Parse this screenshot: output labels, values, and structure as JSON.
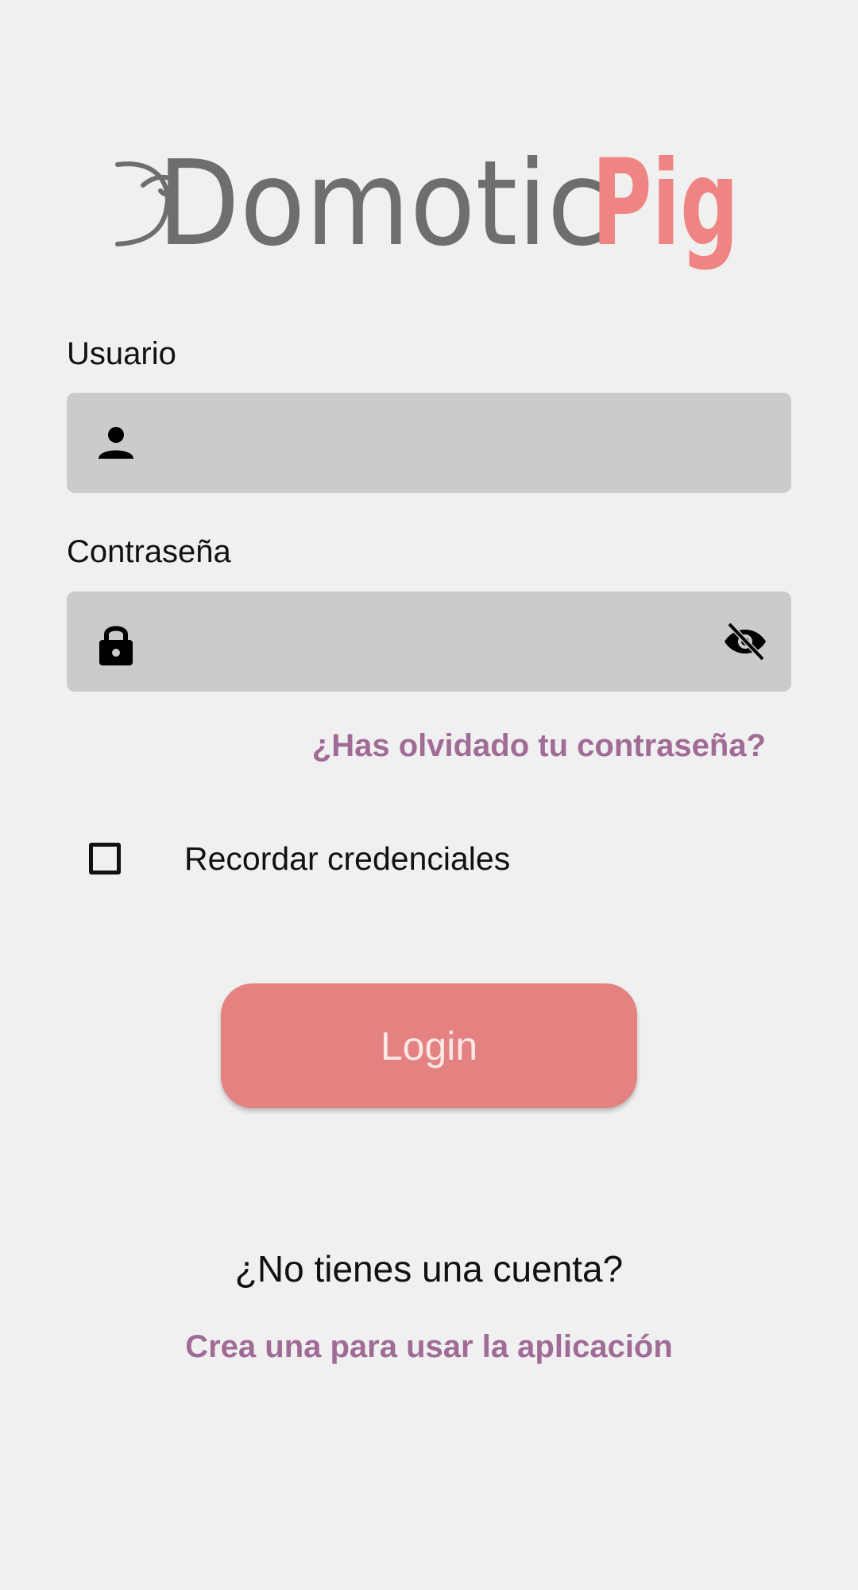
{
  "logo": {
    "part1": "Domotic",
    "part2": "Pig",
    "colors": {
      "gray": "#6e6e6e",
      "pink": "#ef8583"
    }
  },
  "username": {
    "label": "Usuario",
    "value": "",
    "icon": "person-icon"
  },
  "password": {
    "label": "Contraseña",
    "value": "",
    "icon": "lock-icon",
    "toggle_icon": "eye-off-icon"
  },
  "forgot_password": "¿Has olvidado tu contraseña?",
  "remember": {
    "label": "Recordar credenciales",
    "checked": false
  },
  "login_button": "Login",
  "signup": {
    "prompt": "¿No tienes una cuenta?",
    "link": "Crea una para usar la aplicación"
  },
  "colors": {
    "background": "#f0f0f0",
    "input_fill": "#cbcbcb",
    "accent_link": "#a06b96",
    "button": "#e38281",
    "button_text": "#fbe7e6"
  }
}
